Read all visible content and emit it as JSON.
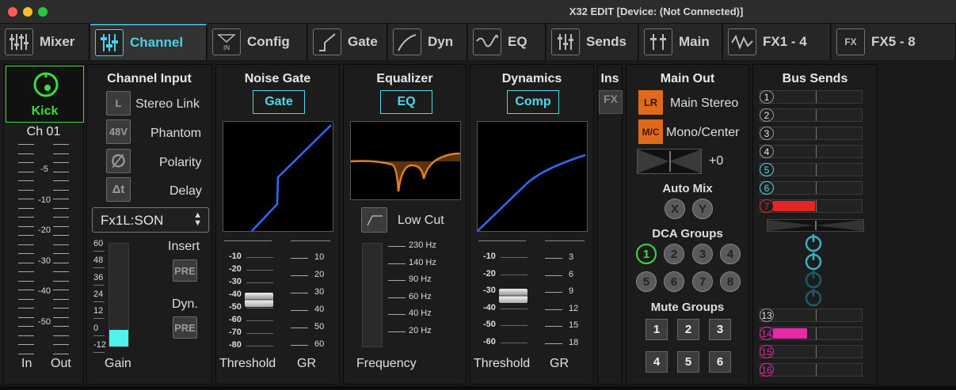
{
  "window": {
    "title": "X32 EDIT [Device: (Not Connected)]"
  },
  "tabs": [
    {
      "label": "Mixer",
      "icon": "mixer-faders-icon"
    },
    {
      "label": "Channel",
      "icon": "channel-sliders-icon",
      "active": true
    },
    {
      "label": "Config",
      "icon": "config-input-icon",
      "icon_text": "IN"
    },
    {
      "label": "Gate",
      "icon": "gate-curve-icon"
    },
    {
      "label": "Dyn",
      "icon": "dynamics-curve-icon"
    },
    {
      "label": "EQ",
      "icon": "eq-curve-icon"
    },
    {
      "label": "Sends",
      "icon": "sends-sliders-icon"
    },
    {
      "label": "Main",
      "icon": "main-lr-icon"
    },
    {
      "label": "FX1 - 4",
      "icon": "fx-wave-icon"
    },
    {
      "label": "FX5 - 8",
      "icon": "fx-box-icon",
      "icon_text": "FX"
    }
  ],
  "strip": {
    "name": "Kick",
    "channel": "Ch 01",
    "meter_scale": [
      "-5",
      "-10",
      "-20",
      "-30",
      "-40",
      "-50"
    ],
    "in_label": "In",
    "out_label": "Out"
  },
  "channel_input": {
    "title": "Channel Input",
    "stereo_link": {
      "icon_text": "L",
      "label": "Stereo Link"
    },
    "phantom": {
      "icon_text": "48V",
      "label": "Phantom"
    },
    "polarity": {
      "icon": "polarity-icon",
      "icon_text": "∅",
      "label": "Polarity"
    },
    "delay": {
      "icon": "delay-icon",
      "icon_text": "Δt",
      "label": "Delay"
    },
    "source": "Fx1L:SON",
    "gain_scale": [
      "60",
      "48",
      "36",
      "24",
      "12",
      "0",
      "-12"
    ],
    "gain_level": 0.06,
    "insert_label": "Insert",
    "insert_pre": "PRE",
    "dyn_label": "Dyn.",
    "dyn_pre": "PRE",
    "gain_label": "Gain"
  },
  "noise_gate": {
    "title": "Noise Gate",
    "button": "Gate",
    "threshold_scale": [
      "-10",
      "-20",
      "-30",
      "-40",
      "-50",
      "-60",
      "-70",
      "-80"
    ],
    "gr_scale": [
      "10",
      "20",
      "30",
      "40",
      "50",
      "60"
    ],
    "threshold_label": "Threshold",
    "gr_label": "GR",
    "threshold_db": -40
  },
  "equalizer": {
    "title": "Equalizer",
    "button": "EQ",
    "low_cut_label": "Low Cut",
    "freq_scale": [
      "230 Hz",
      "140 Hz",
      "90 Hz",
      "60 Hz",
      "40 Hz",
      "20 Hz"
    ],
    "freq_label": "Frequency"
  },
  "dynamics": {
    "title": "Dynamics",
    "button": "Comp",
    "threshold_scale": [
      "-10",
      "-20",
      "-30",
      "-40",
      "-50",
      "-60"
    ],
    "gr_scale": [
      "3",
      "6",
      "9",
      "12",
      "15",
      "18"
    ],
    "threshold_label": "Threshold",
    "gr_label": "GR",
    "threshold_db": -30
  },
  "ins": {
    "title": "Ins",
    "fx_label": "FX"
  },
  "main_out": {
    "title": "Main Out",
    "lr": {
      "badge": "LR",
      "label": "Main Stereo"
    },
    "mc": {
      "badge": "M/C",
      "label": "Mono/Center"
    },
    "pan_value": "+0",
    "automix_title": "Auto Mix",
    "automix": [
      "X",
      "Y"
    ],
    "dca_title": "DCA Groups",
    "dca": [
      "1",
      "2",
      "3",
      "4",
      "5",
      "6",
      "7",
      "8"
    ],
    "mute_title": "Mute Groups",
    "mute": [
      "1",
      "2",
      "3",
      "4",
      "5",
      "6"
    ]
  },
  "bus_sends": {
    "title": "Bus Sends",
    "buses": [
      {
        "n": "1",
        "level": 0,
        "color": ""
      },
      {
        "n": "2",
        "level": 0,
        "color": ""
      },
      {
        "n": "3",
        "level": 0,
        "color": ""
      },
      {
        "n": "4",
        "level": 0,
        "color": ""
      },
      {
        "n": "5",
        "level": 0,
        "color": "#4cd9ee"
      },
      {
        "n": "6",
        "level": 0,
        "color": "#4cd9ee"
      },
      {
        "n": "7",
        "level": 0.47,
        "color": "#e32626"
      },
      {
        "n": "13",
        "level": 0,
        "color": ""
      },
      {
        "n": "14",
        "level": 0.38,
        "color": "#e52aa8"
      },
      {
        "n": "15",
        "level": 0,
        "color": "#e52aa8"
      },
      {
        "n": "16",
        "level": 0,
        "color": "#e52aa8"
      }
    ]
  },
  "colors": {
    "accent": "#4cd9ee",
    "green": "#3ddc3d",
    "orange": "#e06a1c",
    "blue_curve": "#2f6bff",
    "eq_curve": "#e0811f"
  }
}
